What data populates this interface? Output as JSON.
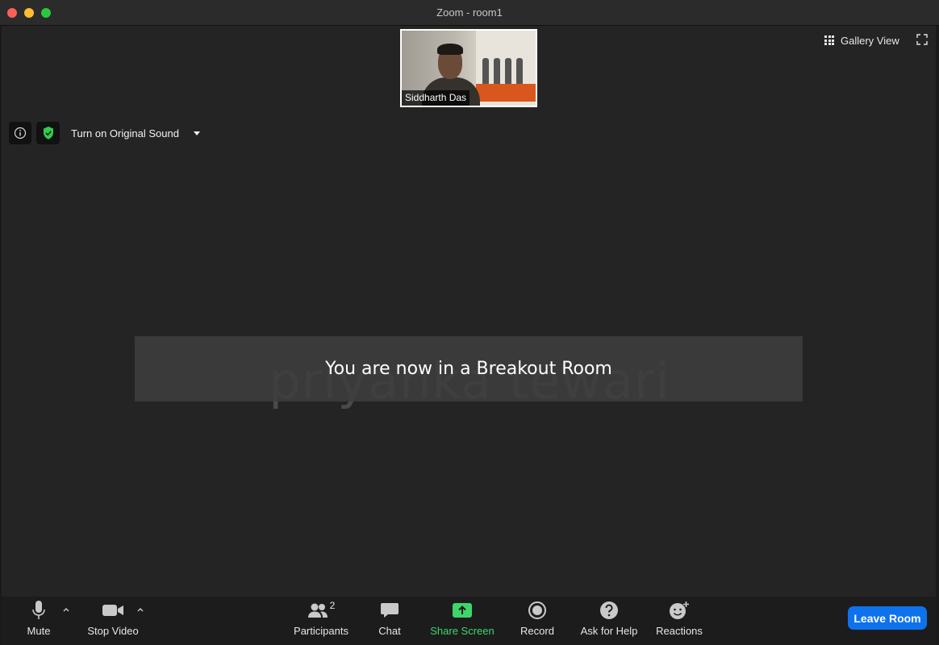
{
  "window": {
    "title": "Zoom - room1"
  },
  "thumbnail": {
    "participant_name": "Siddharth Das"
  },
  "view": {
    "gallery_label": "Gallery View"
  },
  "audio": {
    "original_sound_label": "Turn on Original Sound"
  },
  "main": {
    "speaker_name": "priyanka tewari",
    "banner_text": "You are now in a Breakout Room"
  },
  "toolbar": {
    "mute_label": "Mute",
    "stop_video_label": "Stop Video",
    "participants_label": "Participants",
    "participants_count": "2",
    "chat_label": "Chat",
    "share_screen_label": "Share Screen",
    "record_label": "Record",
    "ask_help_label": "Ask for Help",
    "reactions_label": "Reactions",
    "leave_label": "Leave Room"
  },
  "colors": {
    "share_screen": "#3ed66b",
    "leave_button": "#0e72ed",
    "shield": "#2ecc4f"
  },
  "icons": [
    "microphone-icon",
    "video-camera-icon",
    "participants-icon",
    "chat-icon",
    "share-screen-icon",
    "record-icon",
    "help-icon",
    "reactions-icon",
    "info-icon",
    "shield-icon",
    "grid-icon",
    "fullscreen-icon"
  ]
}
